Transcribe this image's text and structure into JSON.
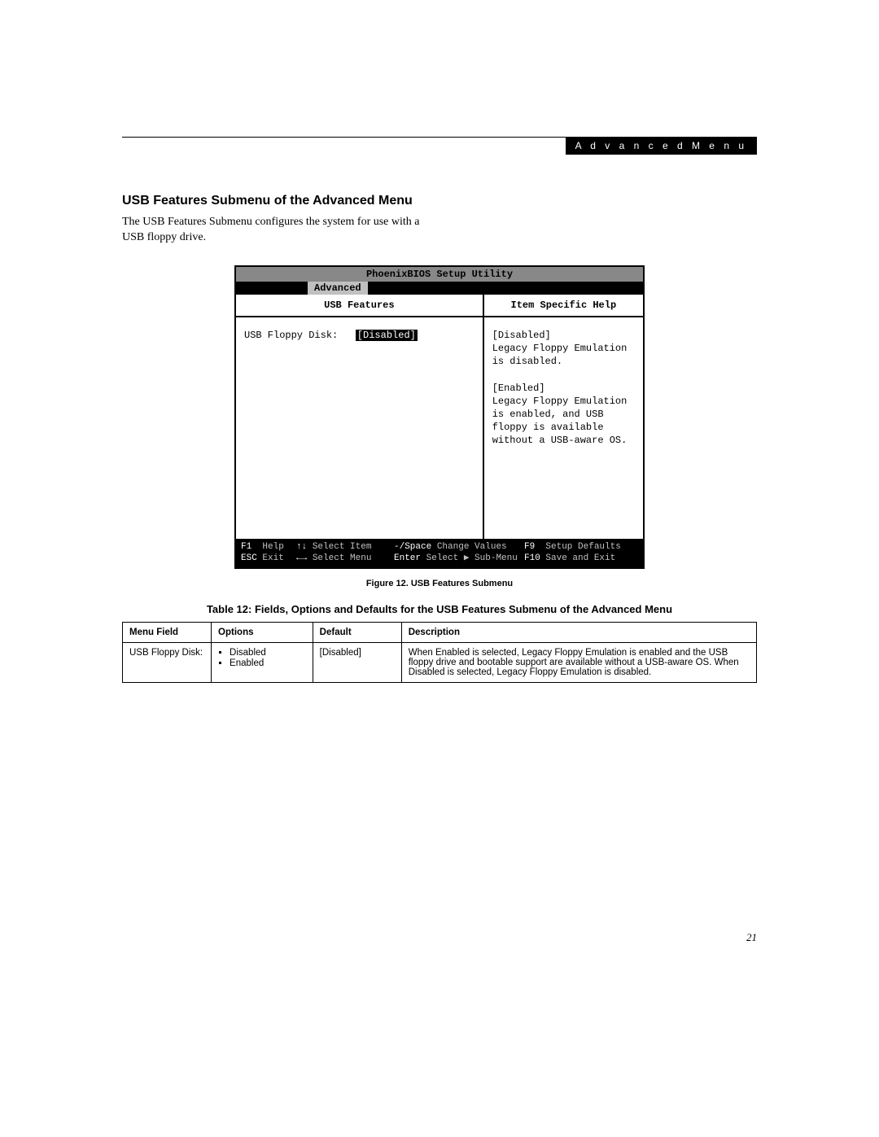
{
  "header": {
    "right_label": "A d v a n c e d   M e n u"
  },
  "section": {
    "title": "USB Features Submenu of the Advanced Menu",
    "intro": "The USB Features Submenu configures the system for use with a USB floppy drive."
  },
  "bios": {
    "title": "PhoenixBIOS Setup Utility",
    "active_tab": "Advanced",
    "left_heading": "USB Features",
    "right_heading": "Item Specific Help",
    "item_label": "USB Floppy Disk:",
    "item_value": "[Disabled]",
    "help": {
      "opt1_header": "[Disabled]",
      "opt1_text": "Legacy Floppy Emulation is disabled.",
      "opt2_header": "[Enabled]",
      "opt2_text": "Legacy Floppy Emulation is enabled, and USB floppy is available without a USB-aware OS."
    },
    "footer": {
      "r1c1_k": "F1",
      "r1c1_t": "Help",
      "r1c2_k": "↑↓",
      "r1c2_t": "Select Item",
      "r1c3_k": "-/Space",
      "r1c3_t": "Change Values",
      "r1c4_k": "F9",
      "r1c4_t": "Setup Defaults",
      "r2c1_k": "ESC",
      "r2c1_t": "Exit",
      "r2c2_k": "←→",
      "r2c2_t": "Select Menu",
      "r2c3_k": "Enter",
      "r2c3_t": "Select ▶ Sub-Menu",
      "r2c4_k": "F10",
      "r2c4_t": "Save and Exit"
    }
  },
  "figure_caption": "Figure 12.  USB Features Submenu",
  "table": {
    "title": "Table 12: Fields, Options and Defaults for the USB Features Submenu of the Advanced Menu",
    "headers": {
      "c1": "Menu Field",
      "c2": "Options",
      "c3": "Default",
      "c4": "Description"
    },
    "row1": {
      "field": "USB Floppy Disk:",
      "opt1": "Disabled",
      "opt2": "Enabled",
      "default": "[Disabled]",
      "description": "When Enabled is selected, Legacy Floppy Emulation is enabled and the USB floppy drive and bootable support are available without a USB-aware OS. When Disabled is selected, Legacy Floppy Emulation is disabled."
    }
  },
  "page_number": "21"
}
